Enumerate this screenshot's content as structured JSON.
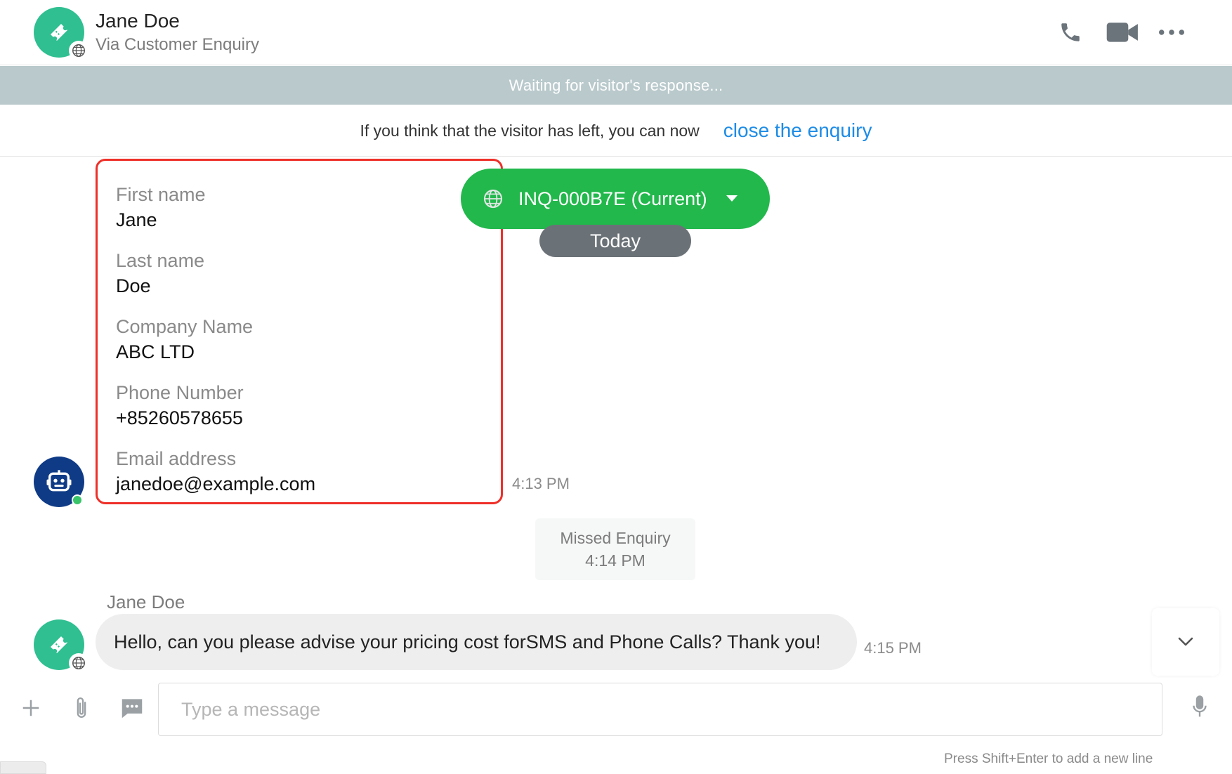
{
  "header": {
    "contact_name": "Jane Doe",
    "contact_source": "Via Customer Enquiry",
    "icons": [
      "phone-icon",
      "video-icon",
      "more-icon"
    ]
  },
  "status": {
    "banner": "Waiting for visitor's response...",
    "close_message": "If you think that the visitor has left, you can now",
    "close_link": "close the enquiry"
  },
  "form": {
    "fields": [
      {
        "label": "First name",
        "value": "Jane"
      },
      {
        "label": "Last name",
        "value": "Doe"
      },
      {
        "label": "Company Name",
        "value": "ABC LTD"
      },
      {
        "label": "Phone Number",
        "value": "+85260578655"
      },
      {
        "label": "Email address",
        "value": "janedoe@example.com"
      }
    ],
    "time": "4:13 PM"
  },
  "inquiry": {
    "label": "INQ-000B7E (Current)",
    "date_divider": "Today"
  },
  "missed": {
    "label": "Missed Enquiry",
    "time": "4:14 PM"
  },
  "message": {
    "sender": "Jane Doe",
    "text": "Hello, can you please advise your pricing cost forSMS and Phone Calls? Thank you!",
    "time": "4:15 PM"
  },
  "composer": {
    "placeholder": "Type a message",
    "hint": "Press Shift+Enter to add a new line"
  },
  "colors": {
    "accent_green": "#22b84c",
    "avatar_teal": "#2fbf91",
    "bot_navy": "#0f3b86",
    "link_blue": "#1e8ce6",
    "banner_gray": "#b9c9cc",
    "highlight_red": "#ee3029"
  }
}
